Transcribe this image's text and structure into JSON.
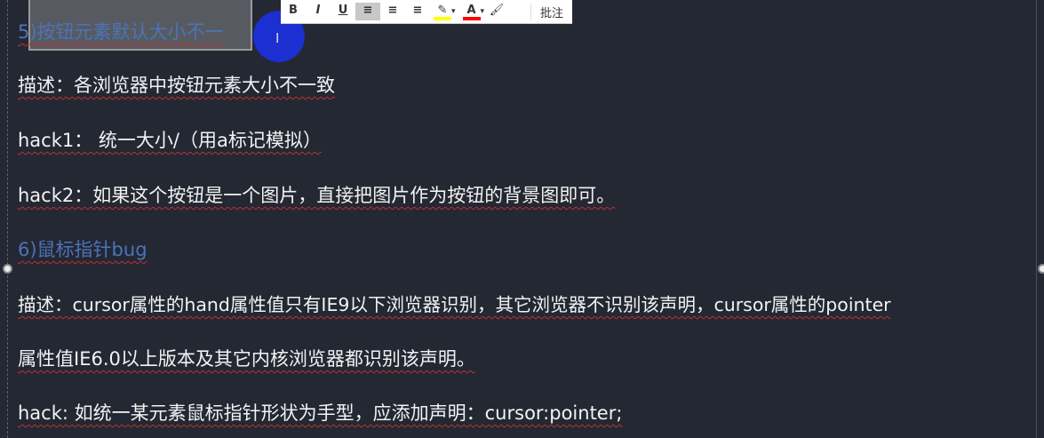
{
  "toolbar": {
    "bold": "B",
    "italic": "I",
    "underline": "U",
    "align_left": "≡",
    "align_center": "≡",
    "align_right": "≡",
    "highlight": "✎",
    "font_color": "A",
    "dropdown": "▾",
    "format_painter": "🖌",
    "comment": "批注",
    "highlight_color": "#ffff00",
    "font_color_value": "#ff0000"
  },
  "doc": {
    "h5": "5)按钮元素默认大小不一",
    "desc5": "描述：各浏览器中按钮元素大小不一致",
    "hack1": "hack1： 统一大小/（用a标记模拟）",
    "hack2": "hack2：如果这个按钮是一个图片，直接把图片作为按钮的背景图即可。",
    "h6": "6)鼠标指针bug",
    "desc6a": "描述：cursor属性的hand属性值只有IE9以下浏览器识别，其它浏览器不识别该声明，cursor属性的pointer",
    "desc6b": "属性值IE6.0以上版本及其它内核浏览器都识别该声明。",
    "hack6": "hack: 如统一某元素鼠标指针形状为手型，应添加声明：cursor:pointer;"
  },
  "colors": {
    "background": "#232833",
    "heading": "#4d73b8",
    "text": "#f2f2f2"
  }
}
